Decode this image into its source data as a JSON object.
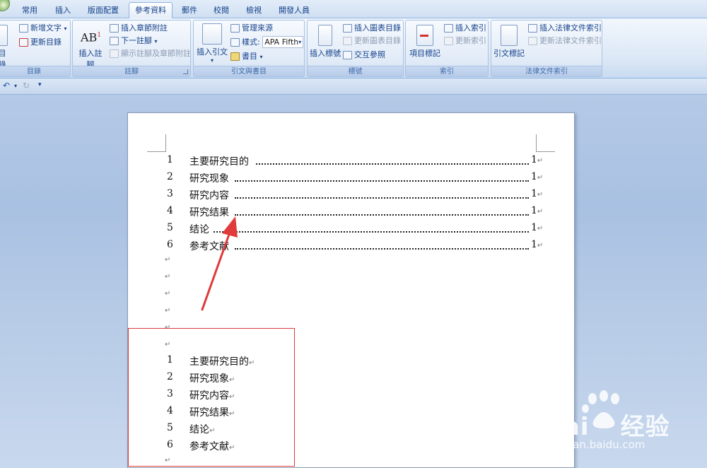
{
  "tabs": [
    "常用",
    "插入",
    "版面配置",
    "參考資料",
    "郵件",
    "校閱",
    "檢視",
    "開發人員"
  ],
  "active_tab": "參考資料",
  "groups": {
    "toc": {
      "label": "目錄",
      "big_button": "目錄",
      "add_text": "新增文字",
      "update_toc": "更新目錄"
    },
    "footnotes": {
      "label": "註腳",
      "insert_footnote": "插入註腳",
      "insert_endnote": "插入章節附註",
      "next_footnote": "下一註腳",
      "show_notes": "顯示註腳及章節附註"
    },
    "citations": {
      "label": "引文與書目",
      "insert_citation": "插入引文",
      "manage_sources": "管理來源",
      "style_label": "樣式:",
      "style_value": "APA Fifth",
      "bibliography": "書目"
    },
    "captions": {
      "label": "標號",
      "insert_caption": "插入標號",
      "insert_table_of_figures": "插入圖表目錄",
      "update_table": "更新圖表目錄",
      "cross_reference": "交互參照"
    },
    "index": {
      "label": "索引",
      "mark_entry": "項目標記",
      "insert_index": "插入索引",
      "update_index": "更新索引"
    },
    "authorities": {
      "label": "法律文件索引",
      "mark_citation": "引文標記",
      "insert_table": "插入法律文件索引",
      "update_table": "更新法律文件索引"
    }
  },
  "document": {
    "toc_entries": [
      {
        "num": "1",
        "text": "主要研究目的",
        "page": "1"
      },
      {
        "num": "2",
        "text": "研究现象",
        "page": "1"
      },
      {
        "num": "3",
        "text": "研究内容",
        "page": "1"
      },
      {
        "num": "4",
        "text": "研究结果",
        "page": "1"
      },
      {
        "num": "5",
        "text": "结论",
        "page": "1"
      },
      {
        "num": "6",
        "text": "参考文献",
        "page": "1"
      }
    ],
    "headings": [
      {
        "num": "1",
        "text": "主要研究目的"
      },
      {
        "num": "2",
        "text": "研究现象"
      },
      {
        "num": "3",
        "text": "研究内容"
      },
      {
        "num": "4",
        "text": "研究结果"
      },
      {
        "num": "5",
        "text": "结论"
      },
      {
        "num": "6",
        "text": "参考文献"
      }
    ],
    "para_mark": "↵"
  },
  "watermark": {
    "brand": "Bai",
    "brand_cn": "经验",
    "url": "jingyan.baidu.com"
  },
  "colors": {
    "accent": "#15428b",
    "annotation_red": "#e03a3a",
    "ribbon_bg": "#dbe7f5",
    "workspace_bg": "#b4c9e6"
  }
}
